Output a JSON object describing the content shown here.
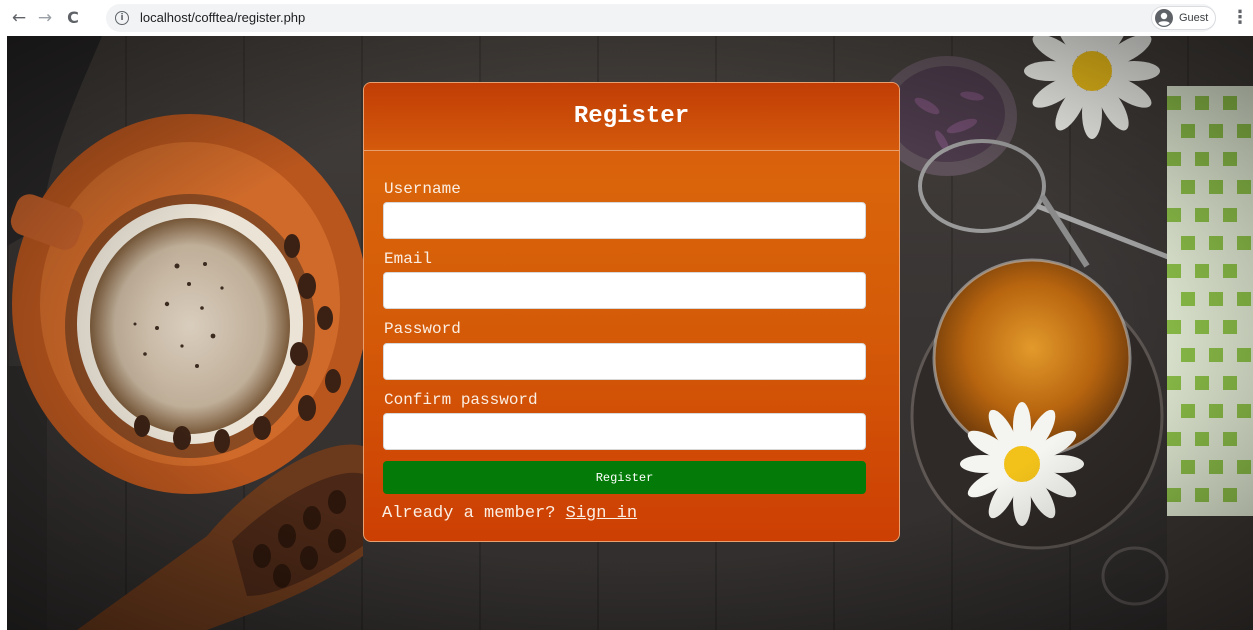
{
  "browser": {
    "url": "localhost/cofftea/register.php",
    "profile_label": "Guest",
    "back_glyph": "←",
    "forward_glyph": "→",
    "reload_glyph": "C",
    "info_glyph": "i",
    "menu_glyph": "⋮"
  },
  "form": {
    "title": "Register",
    "fields": [
      {
        "label": "Username",
        "value": ""
      },
      {
        "label": "Email",
        "value": ""
      },
      {
        "label": "Password",
        "value": ""
      },
      {
        "label": "Confirm password",
        "value": ""
      }
    ],
    "submit_label": "Register",
    "footer_text": "Already a member? ",
    "signin_link": "Sign in"
  },
  "colors": {
    "card_top": "#d95512",
    "card_bottom": "#cd3f03",
    "submit_button": "#047b08",
    "text_light": "#fbeee3",
    "background_wood": "#3a3532"
  },
  "icons": {
    "back": "back-arrow-icon",
    "forward": "forward-arrow-icon",
    "reload": "reload-icon",
    "site_info": "info-icon",
    "profile": "account-circle-icon",
    "menu": "more-vert-icon"
  }
}
